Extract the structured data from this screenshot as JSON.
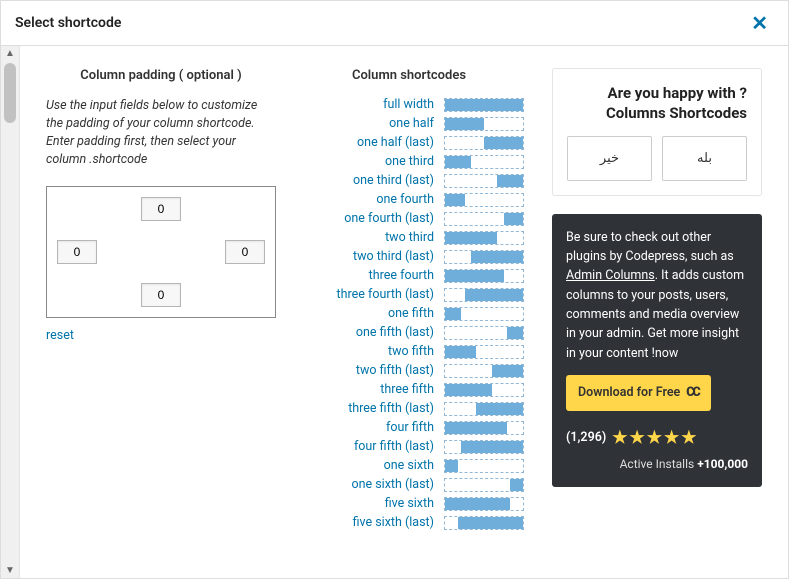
{
  "modal": {
    "title": "Select shortcode"
  },
  "padding": {
    "heading": "Column padding ( optional )",
    "description": "Use the input fields below to customize the padding of your column shortcode. Enter padding first, then select your column .shortcode",
    "top": "0",
    "right": "0",
    "bottom": "0",
    "left": "0",
    "reset": "reset"
  },
  "shortcodes": {
    "heading": "Column shortcodes",
    "items": [
      {
        "label": "full width",
        "fill": 100
      },
      {
        "label": "one half",
        "fill": 50
      },
      {
        "label": "one half (last)",
        "fill": 50,
        "last": true
      },
      {
        "label": "one third",
        "fill": 33.33
      },
      {
        "label": "one third (last)",
        "fill": 33.33,
        "last": true
      },
      {
        "label": "one fourth",
        "fill": 25
      },
      {
        "label": "one fourth (last)",
        "fill": 25,
        "last": true
      },
      {
        "label": "two third",
        "fill": 66.66
      },
      {
        "label": "two third (last)",
        "fill": 66.66,
        "last": true
      },
      {
        "label": "three fourth",
        "fill": 75
      },
      {
        "label": "three fourth (last)",
        "fill": 75,
        "last": true
      },
      {
        "label": "one fifth",
        "fill": 20
      },
      {
        "label": "one fifth (last)",
        "fill": 20,
        "last": true
      },
      {
        "label": "two fifth",
        "fill": 40
      },
      {
        "label": "two fifth (last)",
        "fill": 40,
        "last": true
      },
      {
        "label": "three fifth",
        "fill": 60
      },
      {
        "label": "three fifth (last)",
        "fill": 60,
        "last": true
      },
      {
        "label": "four fifth",
        "fill": 80
      },
      {
        "label": "four fifth (last)",
        "fill": 80,
        "last": true
      },
      {
        "label": "one sixth",
        "fill": 16.66
      },
      {
        "label": "one sixth (last)",
        "fill": 16.66,
        "last": true
      },
      {
        "label": "five sixth",
        "fill": 83.33
      },
      {
        "label": "five sixth (last)",
        "fill": 83.33,
        "last": true
      }
    ]
  },
  "survey": {
    "question": "Are you happy with ?Columns Shortcodes",
    "no": "خیر",
    "yes": "بله"
  },
  "promo": {
    "text_1": "Be sure to check out other plugins by Codepress, such as ",
    "link_text": "Admin Columns",
    "text_2": ". It adds custom columns to your posts, users, comments and media overview in your admin. Get more insight in your content !now",
    "download": "Download for Free",
    "rating_count": "(1,296)",
    "installs_label": "Active Installs",
    "installs_value": "+100,000"
  }
}
